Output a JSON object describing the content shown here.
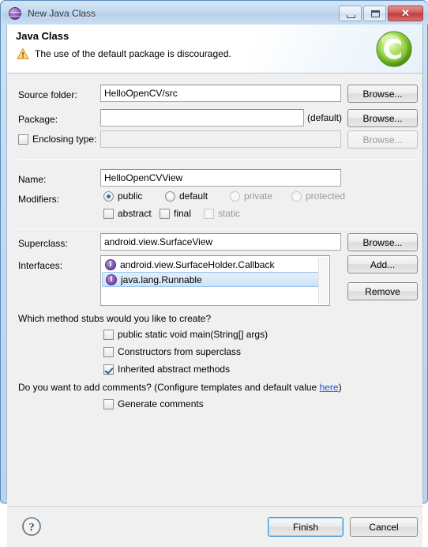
{
  "window": {
    "title": "New Java Class",
    "title_icon": "java-package-sphere-icon",
    "buttons": {
      "minimize": "minimize-icon",
      "maximize": "maximize-icon",
      "close": "✕"
    }
  },
  "header": {
    "title": "Java Class",
    "message": "The use of the default package is discouraged.",
    "message_icon": "warning-triangle-icon",
    "badge_icon": "java-class-green-c-icon",
    "badge_letter": "C"
  },
  "form": {
    "source_folder": {
      "label": "Source folder:",
      "value": "HelloOpenCV/src",
      "browse_label": "Browse..."
    },
    "package": {
      "label": "Package:",
      "value": "",
      "placeholder": "",
      "suffix": "(default)",
      "browse_label": "Browse..."
    },
    "enclosing_type": {
      "label": "Enclosing type:",
      "checked": false,
      "value": "",
      "browse_label": "Browse...",
      "disabled": true
    },
    "name": {
      "label": "Name:",
      "value": "HelloOpenCVView"
    },
    "modifiers": {
      "label": "Modifiers:",
      "radios": [
        {
          "label": "public",
          "checked": true,
          "disabled": false
        },
        {
          "label": "default",
          "checked": false,
          "disabled": false
        },
        {
          "label": "private",
          "checked": false,
          "disabled": true
        },
        {
          "label": "protected",
          "checked": false,
          "disabled": true
        }
      ],
      "checkboxes": [
        {
          "label": "abstract",
          "checked": false,
          "disabled": false
        },
        {
          "label": "final",
          "checked": false,
          "disabled": false
        },
        {
          "label": "static",
          "checked": false,
          "disabled": true
        }
      ]
    },
    "superclass": {
      "label": "Superclass:",
      "value": "android.view.SurfaceView",
      "browse_label": "Browse..."
    },
    "interfaces": {
      "label": "Interfaces:",
      "items": [
        {
          "text": "android.view.SurfaceHolder.Callback",
          "selected": false
        },
        {
          "text": "java.lang.Runnable",
          "selected": true
        }
      ],
      "add_label": "Add...",
      "remove_label": "Remove"
    }
  },
  "stubs": {
    "question": "Which method stubs would you like to create?",
    "checkboxes": [
      {
        "label": "public static void main(String[] args)",
        "checked": false
      },
      {
        "label": "Constructors from superclass",
        "checked": false
      },
      {
        "label": "Inherited abstract methods",
        "checked": true
      }
    ]
  },
  "comments": {
    "question_prefix": "Do you want to add comments? (Configure templates and default value ",
    "link": "here",
    "question_suffix": ")",
    "checkbox": {
      "label": "Generate comments",
      "checked": false
    }
  },
  "footer": {
    "help_icon": "help-question-icon",
    "finish_label": "Finish",
    "cancel_label": "Cancel"
  },
  "colors": {
    "frame": "#b9d4ec",
    "accent_blue": "#3c97d4",
    "link": "#1c4fd8",
    "warning": "#f0a32a",
    "interface_purple": "#6a3f9c",
    "class_green": "#7ac943",
    "close_red": "#bf3c3c"
  }
}
